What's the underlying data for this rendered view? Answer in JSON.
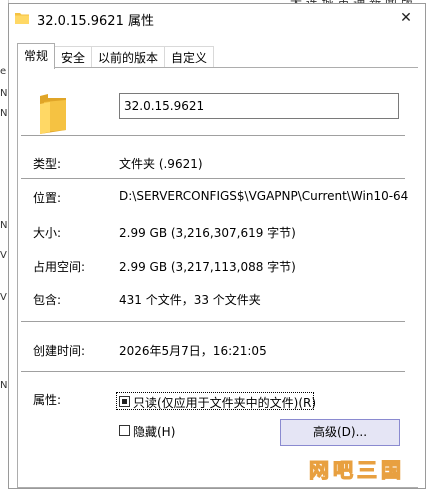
{
  "window": {
    "title": "32.0.15.9621 属性",
    "close_glyph": "✕"
  },
  "background": {
    "top_right_text": "大 连 城 市 通 新 闻 版",
    "left_strip_chars": [
      "e",
      "N",
      "N",
      "N",
      "V",
      "V",
      "N"
    ]
  },
  "tabs": [
    {
      "label": "常规",
      "active": true
    },
    {
      "label": "安全",
      "active": false
    },
    {
      "label": "以前的版本",
      "active": false
    },
    {
      "label": "自定义",
      "active": false
    }
  ],
  "general": {
    "name_value": "32.0.15.9621",
    "rows": {
      "type": {
        "label": "类型:",
        "value": "文件夹 (.9621)"
      },
      "location": {
        "label": "位置:",
        "value": "D:\\SERVERCONFIGS$\\VGAPNP\\Current\\Win10-64"
      },
      "size": {
        "label": "大小:",
        "value": "2.99 GB (3,216,307,619 字节)"
      },
      "size_on_disk": {
        "label": "占用空间:",
        "value": "2.99 GB (3,217,113,088 字节)"
      },
      "contains": {
        "label": "包含:",
        "value": "431 个文件，33 个文件夹"
      },
      "created": {
        "label": "创建时间:",
        "value": "2026年5月7日，16:21:05"
      },
      "attributes": {
        "label": "属性:"
      }
    },
    "readonly_label": "只读(仅应用于文件夹中的文件)(R)",
    "hidden_label": "隐藏(H)",
    "advanced_button": "高级(D)..."
  },
  "watermark": {
    "text": "网吧三国",
    "color": "#e8a040"
  },
  "colors": {
    "folder": "#f5c242",
    "folder_dark": "#e0a528",
    "button_bg": "#e5e5f5",
    "button_border": "#8a8ad0"
  }
}
